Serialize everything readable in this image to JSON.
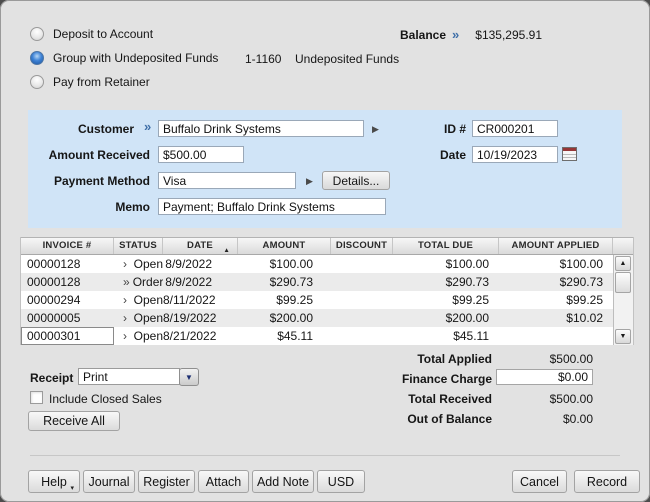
{
  "deposit_options": {
    "items": [
      {
        "label": "Deposit to Account",
        "selected": false
      },
      {
        "label": "Group with Undeposited Funds",
        "selected": true
      },
      {
        "label": "Pay from Retainer",
        "selected": false
      }
    ],
    "undeposited_account_number": "1-1160",
    "undeposited_account_name": "Undeposited Funds"
  },
  "balance": {
    "label": "Balance",
    "value": "$135,295.91"
  },
  "payment_form": {
    "customer_label": "Customer",
    "customer_value": "Buffalo Drink Systems",
    "amount_received_label": "Amount Received",
    "amount_received_value": "$500.00",
    "payment_method_label": "Payment Method",
    "payment_method_value": "Visa",
    "details_button_label": "Details...",
    "memo_label": "Memo",
    "memo_value": "Payment; Buffalo Drink Systems",
    "id_label": "ID #",
    "id_value": "CR000201",
    "date_label": "Date",
    "date_value": "10/19/2023"
  },
  "invoice_table": {
    "headers": {
      "invoice": "INVOICE #",
      "status": "STATUS",
      "date": "DATE",
      "amount": "AMOUNT",
      "discount": "DISCOUNT",
      "total_due": "TOTAL DUE",
      "amount_applied": "AMOUNT APPLIED"
    },
    "sort": {
      "column": "DATE",
      "direction": "ascending"
    },
    "rows": [
      {
        "invoice": "00000128",
        "status_arrow": "›",
        "status": "Open",
        "date": "8/9/2022",
        "amount": "$100.00",
        "discount": "",
        "total_due": "$100.00",
        "amount_applied": "$100.00",
        "focused": false
      },
      {
        "invoice": "00000128",
        "status_arrow": "»",
        "status": "Order",
        "date": "8/9/2022",
        "amount": "$290.73",
        "discount": "",
        "total_due": "$290.73",
        "amount_applied": "$290.73",
        "focused": false
      },
      {
        "invoice": "00000294",
        "status_arrow": "›",
        "status": "Open",
        "date": "8/11/2022",
        "amount": "$99.25",
        "discount": "",
        "total_due": "$99.25",
        "amount_applied": "$99.25",
        "focused": false
      },
      {
        "invoice": "00000005",
        "status_arrow": "›",
        "status": "Open",
        "date": "8/19/2022",
        "amount": "$200.00",
        "discount": "",
        "total_due": "$200.00",
        "amount_applied": "$10.02",
        "focused": false
      },
      {
        "invoice": "00000301",
        "status_arrow": "›",
        "status": "Open",
        "date": "8/21/2022",
        "amount": "$45.11",
        "discount": "",
        "total_due": "$45.11",
        "amount_applied": "",
        "focused": true
      }
    ]
  },
  "receipt": {
    "label": "Receipt",
    "selected_option": "Print"
  },
  "include_closed_sales": {
    "label": "Include Closed Sales",
    "checked": false
  },
  "receive_all_button_label": "Receive All",
  "totals": {
    "total_applied": {
      "label": "Total Applied",
      "value": "$500.00"
    },
    "finance_charge": {
      "label": "Finance Charge",
      "value": "$0.00"
    },
    "total_received": {
      "label": "Total Received",
      "value": "$500.00"
    },
    "out_of_balance": {
      "label": "Out of Balance",
      "value": "$0.00"
    }
  },
  "footer": {
    "help": "Help",
    "journal": "Journal",
    "register": "Register",
    "attach": "Attach",
    "add_note": "Add Note",
    "currency": "USD",
    "cancel": "Cancel",
    "record": "Record"
  },
  "icons": {
    "zoom_arrow": "»",
    "flyout_arrow": "▶",
    "sort_asc": "▲",
    "scroll_up": "▲",
    "scroll_down": "▼",
    "dropdown_arrow": "▼",
    "help_menu_arrow": "▾"
  },
  "colors": {
    "panel_blue": "#d0e4f7",
    "radio_selected_blue": "#3f83d6",
    "window_gray": "#e2e2e2"
  }
}
